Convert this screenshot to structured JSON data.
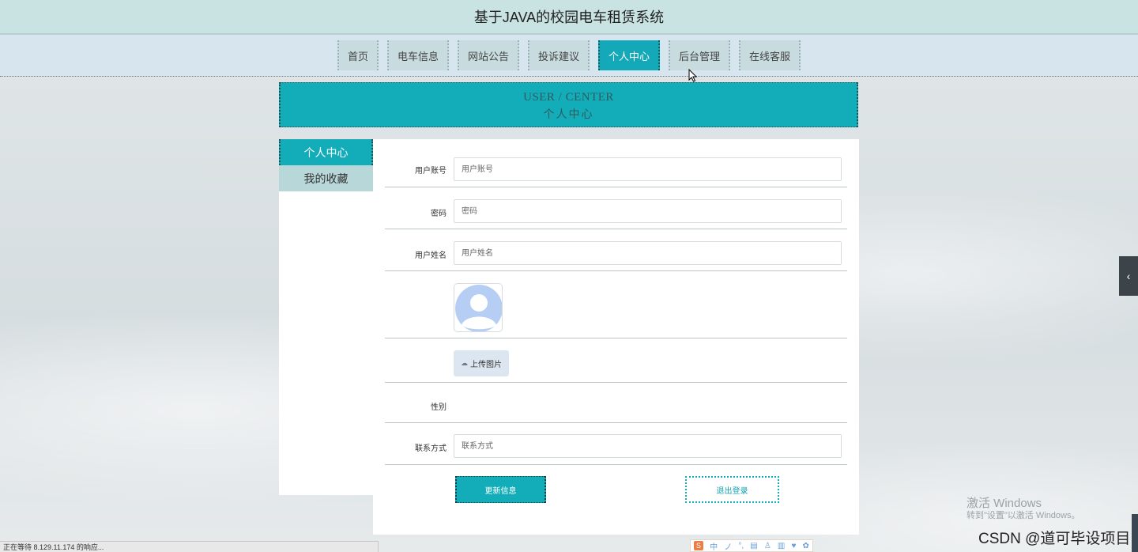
{
  "site_title": "基于JAVA的校园电车租赁系统",
  "nav": {
    "items": [
      {
        "label": "首页",
        "active": false
      },
      {
        "label": "电车信息",
        "active": false
      },
      {
        "label": "网站公告",
        "active": false
      },
      {
        "label": "投诉建议",
        "active": false
      },
      {
        "label": "个人中心",
        "active": true
      },
      {
        "label": "后台管理",
        "active": false
      },
      {
        "label": "在线客服",
        "active": false
      }
    ]
  },
  "banner": {
    "en": "USER / CENTER",
    "cn": "个人中心"
  },
  "sidebar": {
    "items": [
      {
        "label": "个人中心",
        "active": true
      },
      {
        "label": "我的收藏",
        "active": false
      }
    ]
  },
  "form": {
    "account": {
      "label": "用户账号",
      "placeholder": "用户账号",
      "value": ""
    },
    "password": {
      "label": "密码",
      "placeholder": "密码",
      "value": ""
    },
    "name": {
      "label": "用户姓名",
      "placeholder": "用户姓名",
      "value": ""
    },
    "upload_label": "上传图片",
    "gender": {
      "label": "性别",
      "value": ""
    },
    "phone": {
      "label": "联系方式",
      "placeholder": "联系方式",
      "value": ""
    },
    "update_button": "更新信息",
    "logout_button": "退出登录"
  },
  "side_toggle_icon": "chevron-left-icon",
  "watermark": {
    "line1": "激活 Windows",
    "line2": "转到\"设置\"以激活 Windows。"
  },
  "status_bar": "正在等待 8.129.11.174 的响应...",
  "ime_bar": {
    "labels": [
      "中",
      "ノ",
      "°,",
      "▤",
      "♙",
      "▥",
      "♥",
      "✿"
    ]
  },
  "csdn_credit": "CSDN @道可毕设项目",
  "colors": {
    "accent": "#13adb9",
    "header_bg": "#c9e2e2",
    "nav_bg": "#d7e6ee",
    "sidebar_inactive": "#b8d7d9"
  }
}
